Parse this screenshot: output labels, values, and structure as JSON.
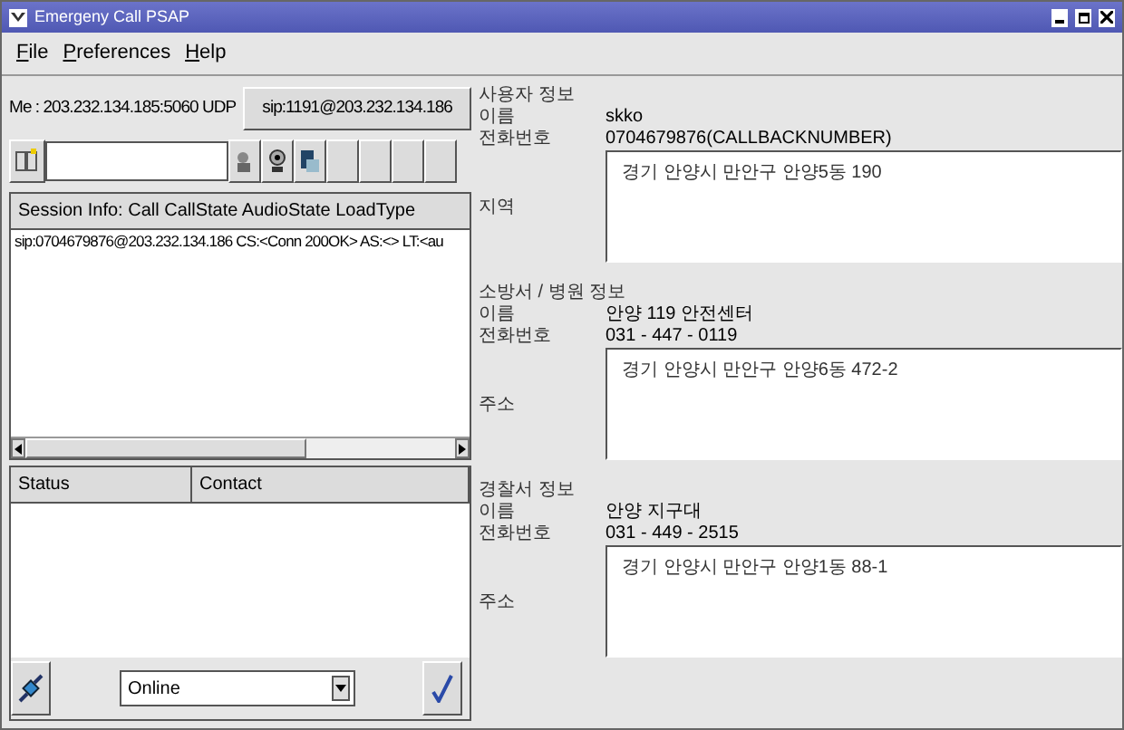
{
  "window": {
    "title": "Emergeny Call PSAP"
  },
  "menu": [
    "File",
    "Preferences",
    "Help"
  ],
  "me": {
    "label": "Me : 203.232.134.185:5060 UDP",
    "sip_button": "sip:1191@203.232.134.186"
  },
  "session": {
    "header": "Session Info: Call CallState AudioState LoadType",
    "rows": [
      "sip:0704679876@203.232.134.186 CS:<Conn 200OK> AS:<> LT:<au"
    ]
  },
  "contacts": {
    "columns": [
      "Status",
      "Contact"
    ]
  },
  "presence": {
    "value": "Online"
  },
  "sections": [
    {
      "title": "사용자 정보",
      "rows": [
        {
          "label": "이름",
          "value": "skko"
        },
        {
          "label": "전화번호",
          "value": "0704679876(CALLBACKNUMBER)"
        }
      ],
      "address_label": "지역",
      "address": "경기 안양시 만안구 안양5동  190"
    },
    {
      "title": "소방서 / 병원 정보",
      "rows": [
        {
          "label": "이름",
          "value": "안양 119 안전센터"
        },
        {
          "label": "전화번호",
          "value": "031 - 447 - 0119"
        }
      ],
      "address_label": "주소",
      "address": "경기 안양시 만안구 안양6동  472-2"
    },
    {
      "title": "경찰서 정보",
      "rows": [
        {
          "label": "이름",
          "value": "안양 지구대"
        },
        {
          "label": "전화번호",
          "value": "031 - 449 - 2515"
        }
      ],
      "address_label": "주소",
      "address": "경기 안양시 만안구 안양1동  88-1"
    }
  ]
}
